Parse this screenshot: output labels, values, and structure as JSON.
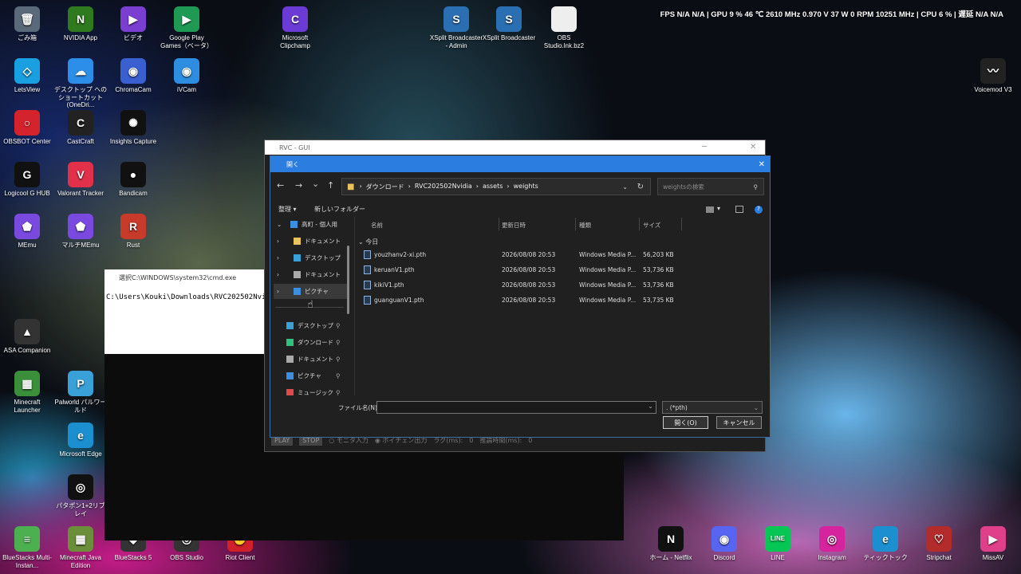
{
  "hud": "FPS  N/A  N/A  |  GPU  9 %  46 ℃  2610 MHz  0.970 V  37 W  0 RPM  10251 MHz  |  CPU  6 %  |  遅延  N/A  N/A",
  "desktop_icons": [
    {
      "label": "ごみ箱",
      "color": "#5b6a7a",
      "glyph": "🗑"
    },
    {
      "label": "NVIDIA App",
      "color": "#2f7a1e",
      "glyph": "N"
    },
    {
      "label": "ビデオ",
      "color": "#7a3fd0",
      "glyph": "▶"
    },
    {
      "label": "Google Play Games（ベータ）",
      "color": "#1f9a55",
      "glyph": "▶"
    },
    {
      "label": "Microsoft Clipchamp",
      "color": "#6c3bd6",
      "glyph": "C"
    },
    {
      "label": "XSplit Broadcaster - Admin",
      "color": "#2a6fb2",
      "glyph": "S"
    },
    {
      "label": "XSplit Broadcaster",
      "color": "#2a6fb2",
      "glyph": "S"
    },
    {
      "label": "OBS Studio.lnk.bz2",
      "color": "#eeeeee",
      "glyph": ""
    },
    {
      "label": "LetsView",
      "color": "#1aa0e0",
      "glyph": "◇"
    },
    {
      "label": "デスクトップ へのショートカット (OneDri...",
      "color": "#2c8ee8",
      "glyph": "☁"
    },
    {
      "label": "ChromaCam",
      "color": "#3a5fd0",
      "glyph": "◉"
    },
    {
      "label": "iVCam",
      "color": "#2d8de0",
      "glyph": "◉"
    },
    {
      "label": "Voicemod V3",
      "color": "#222222",
      "glyph": "〰"
    },
    {
      "label": "OBSBOT Center",
      "color": "#d4232c",
      "glyph": "○"
    },
    {
      "label": "CastCraft",
      "color": "#222222",
      "glyph": "C"
    },
    {
      "label": "Insights Capture",
      "color": "#111111",
      "glyph": "✺"
    },
    {
      "label": "Logicool G HUB",
      "color": "#111111",
      "glyph": "G"
    },
    {
      "label": "Valorant Tracker",
      "color": "#e0304a",
      "glyph": "V"
    },
    {
      "label": "Bandicam",
      "color": "#111111",
      "glyph": "●"
    },
    {
      "label": "MEmu",
      "color": "#7a4ae0",
      "glyph": "⬟"
    },
    {
      "label": "マルチMEmu",
      "color": "#7a4ae0",
      "glyph": "⬟"
    },
    {
      "label": "Rust",
      "color": "#c83a2a",
      "glyph": "R"
    },
    {
      "label": "ASA Companion",
      "color": "#333333",
      "glyph": "▲"
    },
    {
      "label": "Minecraft Launcher",
      "color": "#3b8f3b",
      "glyph": "▦"
    },
    {
      "label": "Palworld パルワールド",
      "color": "#3aa0d8",
      "glyph": "P"
    },
    {
      "label": "Microsoft Edge",
      "color": "#1b8fcf",
      "glyph": "e"
    },
    {
      "label": "パタポン1+2リブレイ",
      "color": "#111111",
      "glyph": "◎"
    },
    {
      "label": "BlueStacks Multi-Instan...",
      "color": "#4caf50",
      "glyph": "≡"
    },
    {
      "label": "Minecraft Java Edition",
      "color": "#6b8e3a",
      "glyph": "▦"
    },
    {
      "label": "BlueStacks 5",
      "color": "#333333",
      "glyph": "◆"
    },
    {
      "label": "OBS Studio",
      "color": "#333333",
      "glyph": "◎"
    },
    {
      "label": "Riot Client",
      "color": "#d0202a",
      "glyph": "✊"
    },
    {
      "label": "ホーム - Netflix",
      "color": "#111111",
      "glyph": "N"
    },
    {
      "label": "Discord",
      "color": "#5865f2",
      "glyph": "◉"
    },
    {
      "label": "LINE",
      "color": "#06c755",
      "glyph": "LINE"
    },
    {
      "label": "Instagram",
      "color": "#d6249f",
      "glyph": "◎"
    },
    {
      "label": "ティックトック",
      "color": "#1b8fcf",
      "glyph": "e"
    },
    {
      "label": "Stripchat",
      "color": "#b32b2b",
      "glyph": "♡"
    },
    {
      "label": "MissAV",
      "color": "#e0408a",
      "glyph": "▶"
    }
  ],
  "cmd": {
    "title": "選択C:\\WINDOWS\\system32\\cmd.exe",
    "line": "C:\\Users\\Kouki\\Downloads\\RVC20250​2Nvidia>"
  },
  "rvc": {
    "title": "RVC - GUI",
    "min": "─",
    "close": "✕",
    "play": "PLAY",
    "stop": "STOP",
    "mon": "モニタ入力",
    "vc": "ボイチェン出力",
    "lat": "ラグ(ms):",
    "lat_v": "0",
    "inf": "推論時間(ms):",
    "inf_v": "0"
  },
  "dialog": {
    "title": "開く",
    "close": "✕",
    "nav": {
      "back": "←",
      "fwd": "→",
      "down": "⌄",
      "up": "↑",
      "refresh": "↻",
      "addr_down": "⌄"
    },
    "path": [
      "ダウンロード",
      "RVC20250​2Nvidia",
      "assets",
      "weights"
    ],
    "search_placeholder": "weightsの検索",
    "organize": "整理 ▾",
    "new_folder": "新しいフォルダー",
    "tree": [
      {
        "label": "高町 - 個人用",
        "color": "#3a8fe0",
        "indent": 0,
        "exp": "⌄",
        "hl": false,
        "pin": false
      },
      {
        "label": "ドキュメント",
        "color": "#e8c45a",
        "indent": 1,
        "exp": "›",
        "hl": false,
        "pin": false
      },
      {
        "label": "デスクトップ",
        "color": "#3aa0d8",
        "indent": 1,
        "exp": "›",
        "hl": false,
        "pin": false
      },
      {
        "label": "ドキュメント",
        "color": "#aaaaaa",
        "indent": 1,
        "exp": "›",
        "hl": false,
        "pin": false
      },
      {
        "label": "ピクチャ",
        "color": "#3a8fe0",
        "indent": 1,
        "exp": "›",
        "hl": true,
        "pin": false
      },
      {
        "label": "デスクトップ",
        "color": "#3aa0d8",
        "indent": 0,
        "exp": "",
        "hl": false,
        "pin": true
      },
      {
        "label": "ダウンロード",
        "color": "#2ec27e",
        "indent": 0,
        "exp": "",
        "hl": false,
        "pin": true
      },
      {
        "label": "ドキュメント",
        "color": "#aaaaaa",
        "indent": 0,
        "exp": "",
        "hl": false,
        "pin": true
      },
      {
        "label": "ピクチャ",
        "color": "#3a8fe0",
        "indent": 0,
        "exp": "",
        "hl": false,
        "pin": true
      },
      {
        "label": "ミュージック",
        "color": "#e04a4a",
        "indent": 0,
        "exp": "",
        "hl": false,
        "pin": true
      }
    ],
    "headers": {
      "name": "名前",
      "date": "更新日時",
      "type": "種類",
      "size": "サイズ"
    },
    "group": "今日",
    "files": [
      {
        "name": "youzhanv2-xi.pth",
        "date": "2026/08/08 20:53",
        "type": "Windows Media P...",
        "size": "56,203 KB"
      },
      {
        "name": "keruanV1.pth",
        "date": "2026/08/08 20:53",
        "type": "Windows Media P...",
        "size": "53,736 KB"
      },
      {
        "name": "kikiV1.pth",
        "date": "2026/08/08 20:53",
        "type": "Windows Media P...",
        "size": "53,736 KB"
      },
      {
        "name": "guanguanV1.pth",
        "date": "2026/08/08 20:53",
        "type": "Windows Media P...",
        "size": "53,735 KB"
      }
    ],
    "filename_label": "ファイル名(N):",
    "filename_value": "",
    "filetype": ". (*pth)",
    "open": "開く(O)",
    "cancel": "キャンセル"
  }
}
